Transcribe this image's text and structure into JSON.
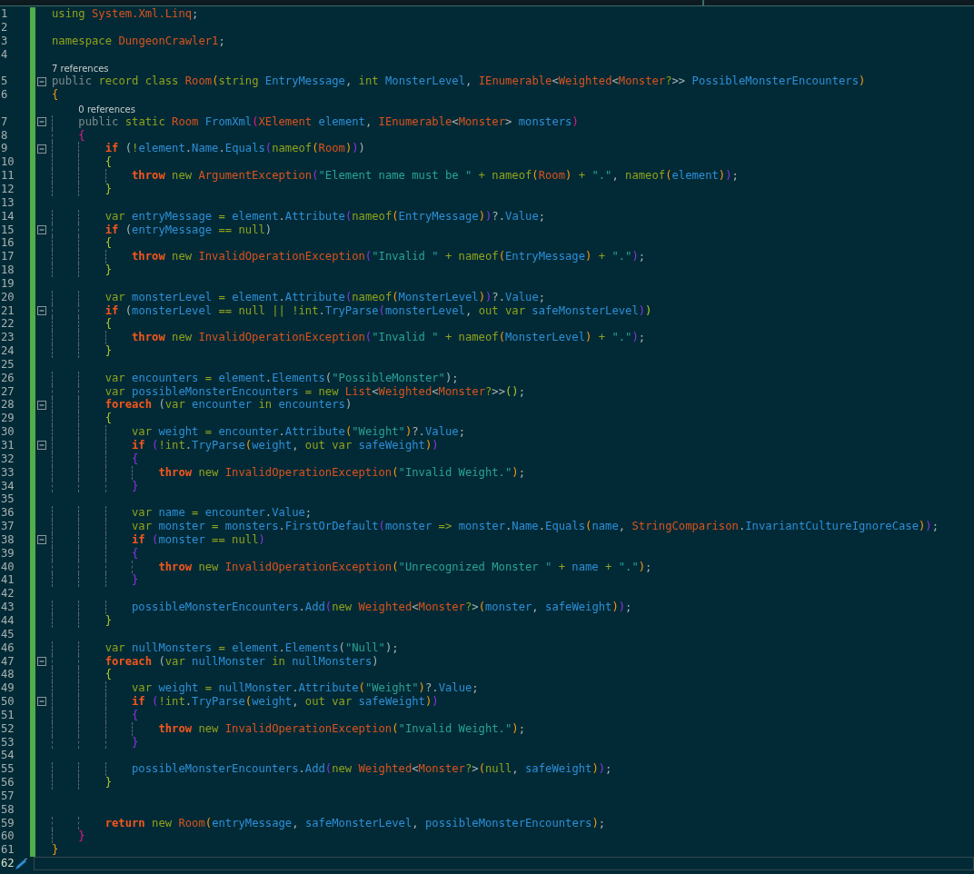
{
  "editor": {
    "lines": [
      {
        "n": "1",
        "modified": true,
        "collapsible": false,
        "current": false,
        "tokens": [
          {
            "kind": "k",
            "text": "using "
          },
          {
            "kind": "t",
            "text": "System.Xml.Linq"
          },
          {
            "kind": "p",
            "text": ";"
          }
        ]
      },
      {
        "n": "2",
        "modified": true,
        "collapsible": false,
        "current": false
      },
      {
        "n": "3",
        "modified": true,
        "collapsible": false,
        "current": false,
        "tokens": [
          {
            "kind": "k",
            "text": "namespace "
          },
          {
            "kind": "t",
            "text": "DungeonCrawler1"
          },
          {
            "kind": "p",
            "text": ";"
          }
        ]
      },
      {
        "n": "4",
        "modified": true,
        "collapsible": false,
        "current": false
      },
      {
        "n": "5",
        "modified": true,
        "collapsible": true,
        "current": false,
        "codelens": "7 references",
        "tokens": [
          {
            "kind": "m",
            "text": "public "
          },
          {
            "kind": "k",
            "text": "record class "
          },
          {
            "kind": "t",
            "text": "Room"
          },
          {
            "kind": "y",
            "text": "("
          },
          {
            "kind": "k",
            "text": "string "
          },
          {
            "kind": "i",
            "text": "EntryMessage"
          },
          {
            "kind": "p",
            "text": ", "
          },
          {
            "kind": "k",
            "text": "int "
          },
          {
            "kind": "i",
            "text": "MonsterLevel"
          },
          {
            "kind": "p",
            "text": ", "
          },
          {
            "kind": "t",
            "text": "IEnumerable"
          },
          {
            "kind": "p",
            "text": "<"
          },
          {
            "kind": "t",
            "text": "Weighted"
          },
          {
            "kind": "p",
            "text": "<"
          },
          {
            "kind": "t",
            "text": "Monster"
          },
          {
            "kind": "k",
            "text": "?"
          },
          {
            "kind": "p",
            "text": ">> "
          },
          {
            "kind": "i",
            "text": "PossibleMonsterEncounters"
          },
          {
            "kind": "y",
            "text": ")"
          }
        ]
      },
      {
        "n": "6",
        "modified": true,
        "collapsible": false,
        "current": false,
        "tokens": [
          {
            "kind": "y",
            "text": "{"
          }
        ]
      },
      {
        "n": "7",
        "modified": true,
        "collapsible": true,
        "current": false,
        "codelens": "0 references",
        "tokens": [
          {
            "kind": "m",
            "text": "    public "
          },
          {
            "kind": "k",
            "text": "static "
          },
          {
            "kind": "t",
            "text": "Room "
          },
          {
            "kind": "i",
            "text": "FromXml"
          },
          {
            "kind": "g",
            "text": "("
          },
          {
            "kind": "t",
            "text": "XElement "
          },
          {
            "kind": "i",
            "text": "element"
          },
          {
            "kind": "p",
            "text": ", "
          },
          {
            "kind": "t",
            "text": "IEnumerable"
          },
          {
            "kind": "p",
            "text": "<"
          },
          {
            "kind": "t",
            "text": "Monster"
          },
          {
            "kind": "p",
            "text": "> "
          },
          {
            "kind": "i",
            "text": "monsters"
          },
          {
            "kind": "g",
            "text": ")"
          }
        ]
      },
      {
        "n": "8",
        "modified": true,
        "collapsible": false,
        "current": false,
        "tokens": [
          {
            "kind": "g",
            "text": "    {"
          }
        ]
      },
      {
        "n": "9",
        "modified": true,
        "collapsible": true,
        "current": false,
        "tokens": [
          {
            "kind": "c",
            "text": "        if "
          },
          {
            "kind": "p",
            "text": "("
          },
          {
            "kind": "k",
            "text": "!"
          },
          {
            "kind": "i",
            "text": "element"
          },
          {
            "kind": "p",
            "text": "."
          },
          {
            "kind": "i",
            "text": "Name"
          },
          {
            "kind": "p",
            "text": "."
          },
          {
            "kind": "i",
            "text": "Equals"
          },
          {
            "kind": "v",
            "text": "("
          },
          {
            "kind": "k",
            "text": "nameof"
          },
          {
            "kind": "y",
            "text": "("
          },
          {
            "kind": "t",
            "text": "Room"
          },
          {
            "kind": "y",
            "text": ")"
          },
          {
            "kind": "v",
            "text": ")"
          },
          {
            "kind": "p",
            "text": ")"
          }
        ]
      },
      {
        "n": "10",
        "modified": true,
        "collapsible": false,
        "current": false,
        "tokens": [
          {
            "kind": "l",
            "text": "        {"
          }
        ]
      },
      {
        "n": "11",
        "modified": true,
        "collapsible": false,
        "current": false,
        "tokens": [
          {
            "kind": "c",
            "text": "            throw "
          },
          {
            "kind": "k",
            "text": "new "
          },
          {
            "kind": "t",
            "text": "ArgumentException"
          },
          {
            "kind": "v",
            "text": "("
          },
          {
            "kind": "s",
            "text": "\"Element name must be \""
          },
          {
            "kind": "k",
            "text": " + nameof"
          },
          {
            "kind": "y",
            "text": "("
          },
          {
            "kind": "t",
            "text": "Room"
          },
          {
            "kind": "y",
            "text": ")"
          },
          {
            "kind": "k",
            "text": " + "
          },
          {
            "kind": "s",
            "text": "\".\""
          },
          {
            "kind": "p",
            "text": ", "
          },
          {
            "kind": "k",
            "text": "nameof"
          },
          {
            "kind": "y",
            "text": "("
          },
          {
            "kind": "i",
            "text": "element"
          },
          {
            "kind": "y",
            "text": ")"
          },
          {
            "kind": "v",
            "text": ")"
          },
          {
            "kind": "p",
            "text": ";"
          }
        ]
      },
      {
        "n": "12",
        "modified": true,
        "collapsible": false,
        "current": false,
        "tokens": [
          {
            "kind": "l",
            "text": "        }"
          }
        ]
      },
      {
        "n": "13",
        "modified": true,
        "collapsible": false,
        "current": false
      },
      {
        "n": "14",
        "modified": true,
        "collapsible": false,
        "current": false,
        "tokens": [
          {
            "kind": "k",
            "text": "        var "
          },
          {
            "kind": "i",
            "text": "entryMessage"
          },
          {
            "kind": "k",
            "text": " = "
          },
          {
            "kind": "i",
            "text": "element"
          },
          {
            "kind": "p",
            "text": "."
          },
          {
            "kind": "i",
            "text": "Attribute"
          },
          {
            "kind": "v",
            "text": "("
          },
          {
            "kind": "k",
            "text": "nameof"
          },
          {
            "kind": "y",
            "text": "("
          },
          {
            "kind": "i",
            "text": "EntryMessage"
          },
          {
            "kind": "y",
            "text": ")"
          },
          {
            "kind": "v",
            "text": ")"
          },
          {
            "kind": "p",
            "text": "?."
          },
          {
            "kind": "i",
            "text": "Value"
          },
          {
            "kind": "p",
            "text": ";"
          }
        ]
      },
      {
        "n": "15",
        "modified": true,
        "collapsible": true,
        "current": false,
        "tokens": [
          {
            "kind": "c",
            "text": "        if "
          },
          {
            "kind": "p",
            "text": "("
          },
          {
            "kind": "i",
            "text": "entryMessage"
          },
          {
            "kind": "k",
            "text": " == null"
          },
          {
            "kind": "p",
            "text": ")"
          }
        ]
      },
      {
        "n": "16",
        "modified": true,
        "collapsible": false,
        "current": false,
        "tokens": [
          {
            "kind": "l",
            "text": "        {"
          }
        ]
      },
      {
        "n": "17",
        "modified": true,
        "collapsible": false,
        "current": false,
        "tokens": [
          {
            "kind": "c",
            "text": "            throw "
          },
          {
            "kind": "k",
            "text": "new "
          },
          {
            "kind": "t",
            "text": "InvalidOperationException"
          },
          {
            "kind": "v",
            "text": "("
          },
          {
            "kind": "s",
            "text": "\"Invalid \""
          },
          {
            "kind": "k",
            "text": " + nameof"
          },
          {
            "kind": "y",
            "text": "("
          },
          {
            "kind": "i",
            "text": "EntryMessage"
          },
          {
            "kind": "y",
            "text": ")"
          },
          {
            "kind": "k",
            "text": " + "
          },
          {
            "kind": "s",
            "text": "\".\""
          },
          {
            "kind": "v",
            "text": ")"
          },
          {
            "kind": "p",
            "text": ";"
          }
        ]
      },
      {
        "n": "18",
        "modified": true,
        "collapsible": false,
        "current": false,
        "tokens": [
          {
            "kind": "l",
            "text": "        }"
          }
        ]
      },
      {
        "n": "19",
        "modified": true,
        "collapsible": false,
        "current": false
      },
      {
        "n": "20",
        "modified": true,
        "collapsible": false,
        "current": false,
        "tokens": [
          {
            "kind": "k",
            "text": "        var "
          },
          {
            "kind": "i",
            "text": "monsterLevel"
          },
          {
            "kind": "k",
            "text": " = "
          },
          {
            "kind": "i",
            "text": "element"
          },
          {
            "kind": "p",
            "text": "."
          },
          {
            "kind": "i",
            "text": "Attribute"
          },
          {
            "kind": "v",
            "text": "("
          },
          {
            "kind": "k",
            "text": "nameof"
          },
          {
            "kind": "y",
            "text": "("
          },
          {
            "kind": "i",
            "text": "MonsterLevel"
          },
          {
            "kind": "y",
            "text": ")"
          },
          {
            "kind": "v",
            "text": ")"
          },
          {
            "kind": "p",
            "text": "?."
          },
          {
            "kind": "i",
            "text": "Value"
          },
          {
            "kind": "p",
            "text": ";"
          }
        ]
      },
      {
        "n": "21",
        "modified": true,
        "collapsible": true,
        "current": false,
        "tokens": [
          {
            "kind": "c",
            "text": "        if "
          },
          {
            "kind": "p",
            "text": "("
          },
          {
            "kind": "i",
            "text": "monsterLevel"
          },
          {
            "kind": "k",
            "text": " == null || !int"
          },
          {
            "kind": "p",
            "text": "."
          },
          {
            "kind": "i",
            "text": "TryParse"
          },
          {
            "kind": "v",
            "text": "("
          },
          {
            "kind": "i",
            "text": "monsterLevel"
          },
          {
            "kind": "p",
            "text": ", "
          },
          {
            "kind": "k",
            "text": "out var "
          },
          {
            "kind": "i",
            "text": "safeMonsterLevel"
          },
          {
            "kind": "v",
            "text": ")"
          },
          {
            "kind": "l",
            "text": ")"
          }
        ]
      },
      {
        "n": "22",
        "modified": true,
        "collapsible": false,
        "current": false,
        "tokens": [
          {
            "kind": "l",
            "text": "        {"
          }
        ]
      },
      {
        "n": "23",
        "modified": true,
        "collapsible": false,
        "current": false,
        "tokens": [
          {
            "kind": "c",
            "text": "            throw "
          },
          {
            "kind": "k",
            "text": "new "
          },
          {
            "kind": "t",
            "text": "InvalidOperationException"
          },
          {
            "kind": "v",
            "text": "("
          },
          {
            "kind": "s",
            "text": "\"Invalid \""
          },
          {
            "kind": "k",
            "text": " + nameof"
          },
          {
            "kind": "y",
            "text": "("
          },
          {
            "kind": "i",
            "text": "MonsterLevel"
          },
          {
            "kind": "y",
            "text": ")"
          },
          {
            "kind": "k",
            "text": " + "
          },
          {
            "kind": "s",
            "text": "\".\""
          },
          {
            "kind": "v",
            "text": ")"
          },
          {
            "kind": "p",
            "text": ";"
          }
        ]
      },
      {
        "n": "24",
        "modified": true,
        "collapsible": false,
        "current": false,
        "tokens": [
          {
            "kind": "l",
            "text": "        }"
          }
        ]
      },
      {
        "n": "25",
        "modified": true,
        "collapsible": false,
        "current": false
      },
      {
        "n": "26",
        "modified": true,
        "collapsible": false,
        "current": false,
        "tokens": [
          {
            "kind": "k",
            "text": "        var "
          },
          {
            "kind": "i",
            "text": "encounters"
          },
          {
            "kind": "k",
            "text": " = "
          },
          {
            "kind": "i",
            "text": "element"
          },
          {
            "kind": "p",
            "text": "."
          },
          {
            "kind": "i",
            "text": "Elements"
          },
          {
            "kind": "p",
            "text": "("
          },
          {
            "kind": "s",
            "text": "\"PossibleMonster\""
          },
          {
            "kind": "p",
            "text": ");"
          }
        ]
      },
      {
        "n": "27",
        "modified": true,
        "collapsible": false,
        "current": false,
        "tokens": [
          {
            "kind": "k",
            "text": "        var "
          },
          {
            "kind": "i",
            "text": "possibleMonsterEncounters"
          },
          {
            "kind": "k",
            "text": " = new "
          },
          {
            "kind": "t",
            "text": "List"
          },
          {
            "kind": "p",
            "text": "<"
          },
          {
            "kind": "t",
            "text": "Weighted"
          },
          {
            "kind": "p",
            "text": "<"
          },
          {
            "kind": "t",
            "text": "Monster"
          },
          {
            "kind": "k",
            "text": "?"
          },
          {
            "kind": "p",
            "text": ">>"
          },
          {
            "kind": "l",
            "text": "()"
          },
          {
            "kind": "p",
            "text": ";"
          }
        ]
      },
      {
        "n": "28",
        "modified": true,
        "collapsible": true,
        "current": false,
        "tokens": [
          {
            "kind": "c",
            "text": "        foreach "
          },
          {
            "kind": "p",
            "text": "("
          },
          {
            "kind": "k",
            "text": "var "
          },
          {
            "kind": "i",
            "text": "encounter"
          },
          {
            "kind": "k",
            "text": " in "
          },
          {
            "kind": "i",
            "text": "encounters"
          },
          {
            "kind": "p",
            "text": ")"
          }
        ]
      },
      {
        "n": "29",
        "modified": true,
        "collapsible": false,
        "current": false,
        "tokens": [
          {
            "kind": "l",
            "text": "        {"
          }
        ]
      },
      {
        "n": "30",
        "modified": true,
        "collapsible": false,
        "current": false,
        "tokens": [
          {
            "kind": "k",
            "text": "            var "
          },
          {
            "kind": "i",
            "text": "weight"
          },
          {
            "kind": "k",
            "text": " = "
          },
          {
            "kind": "i",
            "text": "encounter"
          },
          {
            "kind": "p",
            "text": "."
          },
          {
            "kind": "i",
            "text": "Attribute"
          },
          {
            "kind": "y",
            "text": "("
          },
          {
            "kind": "s",
            "text": "\"Weight\""
          },
          {
            "kind": "y",
            "text": ")"
          },
          {
            "kind": "p",
            "text": "?."
          },
          {
            "kind": "i",
            "text": "Value"
          },
          {
            "kind": "p",
            "text": ";"
          }
        ]
      },
      {
        "n": "31",
        "modified": true,
        "collapsible": true,
        "current": false,
        "tokens": [
          {
            "kind": "c",
            "text": "            if "
          },
          {
            "kind": "v",
            "text": "("
          },
          {
            "kind": "k",
            "text": "!int"
          },
          {
            "kind": "p",
            "text": "."
          },
          {
            "kind": "i",
            "text": "TryParse"
          },
          {
            "kind": "y",
            "text": "("
          },
          {
            "kind": "i",
            "text": "weight"
          },
          {
            "kind": "p",
            "text": ", "
          },
          {
            "kind": "k",
            "text": "out var "
          },
          {
            "kind": "i",
            "text": "safeWeight"
          },
          {
            "kind": "y",
            "text": ")"
          },
          {
            "kind": "v",
            "text": ")"
          }
        ]
      },
      {
        "n": "32",
        "modified": true,
        "collapsible": false,
        "current": false,
        "tokens": [
          {
            "kind": "v",
            "text": "            {"
          }
        ]
      },
      {
        "n": "33",
        "modified": true,
        "collapsible": false,
        "current": false,
        "tokens": [
          {
            "kind": "c",
            "text": "                throw "
          },
          {
            "kind": "k",
            "text": "new "
          },
          {
            "kind": "t",
            "text": "InvalidOperationException"
          },
          {
            "kind": "y",
            "text": "("
          },
          {
            "kind": "s",
            "text": "\"Invalid Weight.\""
          },
          {
            "kind": "y",
            "text": ")"
          },
          {
            "kind": "p",
            "text": ";"
          }
        ]
      },
      {
        "n": "34",
        "modified": true,
        "collapsible": false,
        "current": false,
        "tokens": [
          {
            "kind": "v",
            "text": "            }"
          }
        ]
      },
      {
        "n": "35",
        "modified": true,
        "collapsible": false,
        "current": false
      },
      {
        "n": "36",
        "modified": true,
        "collapsible": false,
        "current": false,
        "tokens": [
          {
            "kind": "k",
            "text": "            var "
          },
          {
            "kind": "i",
            "text": "name"
          },
          {
            "kind": "k",
            "text": " = "
          },
          {
            "kind": "i",
            "text": "encounter"
          },
          {
            "kind": "p",
            "text": "."
          },
          {
            "kind": "i",
            "text": "Value"
          },
          {
            "kind": "p",
            "text": ";"
          }
        ]
      },
      {
        "n": "37",
        "modified": true,
        "collapsible": false,
        "current": false,
        "tokens": [
          {
            "kind": "k",
            "text": "            var "
          },
          {
            "kind": "i",
            "text": "monster"
          },
          {
            "kind": "k",
            "text": " = "
          },
          {
            "kind": "i",
            "text": "monsters"
          },
          {
            "kind": "p",
            "text": "."
          },
          {
            "kind": "i",
            "text": "FirstOrDefault"
          },
          {
            "kind": "v",
            "text": "("
          },
          {
            "kind": "i",
            "text": "monster"
          },
          {
            "kind": "k",
            "text": " => "
          },
          {
            "kind": "i",
            "text": "monster"
          },
          {
            "kind": "p",
            "text": "."
          },
          {
            "kind": "i",
            "text": "Name"
          },
          {
            "kind": "p",
            "text": "."
          },
          {
            "kind": "i",
            "text": "Equals"
          },
          {
            "kind": "y",
            "text": "("
          },
          {
            "kind": "i",
            "text": "name"
          },
          {
            "kind": "p",
            "text": ", "
          },
          {
            "kind": "t",
            "text": "StringComparison"
          },
          {
            "kind": "p",
            "text": "."
          },
          {
            "kind": "i",
            "text": "InvariantCultureIgnoreCase"
          },
          {
            "kind": "y",
            "text": ")"
          },
          {
            "kind": "v",
            "text": ")"
          },
          {
            "kind": "p",
            "text": ";"
          }
        ]
      },
      {
        "n": "38",
        "modified": true,
        "collapsible": true,
        "current": false,
        "tokens": [
          {
            "kind": "c",
            "text": "            if "
          },
          {
            "kind": "v",
            "text": "("
          },
          {
            "kind": "i",
            "text": "monster"
          },
          {
            "kind": "k",
            "text": " == null"
          },
          {
            "kind": "v",
            "text": ")"
          }
        ]
      },
      {
        "n": "39",
        "modified": true,
        "collapsible": false,
        "current": false,
        "tokens": [
          {
            "kind": "v",
            "text": "            {"
          }
        ]
      },
      {
        "n": "40",
        "modified": true,
        "collapsible": false,
        "current": false,
        "tokens": [
          {
            "kind": "c",
            "text": "                throw "
          },
          {
            "kind": "k",
            "text": "new "
          },
          {
            "kind": "t",
            "text": "InvalidOperationException"
          },
          {
            "kind": "y",
            "text": "("
          },
          {
            "kind": "s",
            "text": "\"Unrecognized Monster \""
          },
          {
            "kind": "k",
            "text": " + "
          },
          {
            "kind": "i",
            "text": "name"
          },
          {
            "kind": "k",
            "text": " + "
          },
          {
            "kind": "s",
            "text": "\".\""
          },
          {
            "kind": "y",
            "text": ")"
          },
          {
            "kind": "p",
            "text": ";"
          }
        ]
      },
      {
        "n": "41",
        "modified": true,
        "collapsible": false,
        "current": false,
        "tokens": [
          {
            "kind": "v",
            "text": "            }"
          }
        ]
      },
      {
        "n": "42",
        "modified": true,
        "collapsible": false,
        "current": false
      },
      {
        "n": "43",
        "modified": true,
        "collapsible": false,
        "current": false,
        "tokens": [
          {
            "kind": "i",
            "text": "            possibleMonsterEncounters"
          },
          {
            "kind": "p",
            "text": "."
          },
          {
            "kind": "i",
            "text": "Add"
          },
          {
            "kind": "v",
            "text": "("
          },
          {
            "kind": "k",
            "text": "new "
          },
          {
            "kind": "t",
            "text": "Weighted"
          },
          {
            "kind": "p",
            "text": "<"
          },
          {
            "kind": "t",
            "text": "Monster"
          },
          {
            "kind": "k",
            "text": "?"
          },
          {
            "kind": "p",
            "text": ">"
          },
          {
            "kind": "y",
            "text": "("
          },
          {
            "kind": "i",
            "text": "monster"
          },
          {
            "kind": "p",
            "text": ", "
          },
          {
            "kind": "i",
            "text": "safeWeight"
          },
          {
            "kind": "y",
            "text": ")"
          },
          {
            "kind": "v",
            "text": ")"
          },
          {
            "kind": "p",
            "text": ";"
          }
        ]
      },
      {
        "n": "44",
        "modified": true,
        "collapsible": false,
        "current": false,
        "tokens": [
          {
            "kind": "l",
            "text": "        }"
          }
        ]
      },
      {
        "n": "45",
        "modified": true,
        "collapsible": false,
        "current": false
      },
      {
        "n": "46",
        "modified": true,
        "collapsible": false,
        "current": false,
        "tokens": [
          {
            "kind": "k",
            "text": "        var "
          },
          {
            "kind": "i",
            "text": "nullMonsters"
          },
          {
            "kind": "k",
            "text": " = "
          },
          {
            "kind": "i",
            "text": "element"
          },
          {
            "kind": "p",
            "text": "."
          },
          {
            "kind": "i",
            "text": "Elements"
          },
          {
            "kind": "p",
            "text": "("
          },
          {
            "kind": "s",
            "text": "\"Null\""
          },
          {
            "kind": "p",
            "text": ");"
          }
        ]
      },
      {
        "n": "47",
        "modified": true,
        "collapsible": true,
        "current": false,
        "tokens": [
          {
            "kind": "c",
            "text": "        foreach "
          },
          {
            "kind": "p",
            "text": "("
          },
          {
            "kind": "k",
            "text": "var "
          },
          {
            "kind": "i",
            "text": "nullMonster"
          },
          {
            "kind": "k",
            "text": " in "
          },
          {
            "kind": "i",
            "text": "nullMonsters"
          },
          {
            "kind": "p",
            "text": ")"
          }
        ]
      },
      {
        "n": "48",
        "modified": true,
        "collapsible": false,
        "current": false,
        "tokens": [
          {
            "kind": "l",
            "text": "        {"
          }
        ]
      },
      {
        "n": "49",
        "modified": true,
        "collapsible": false,
        "current": false,
        "tokens": [
          {
            "kind": "k",
            "text": "            var "
          },
          {
            "kind": "i",
            "text": "weight"
          },
          {
            "kind": "k",
            "text": " = "
          },
          {
            "kind": "i",
            "text": "nullMonster"
          },
          {
            "kind": "p",
            "text": "."
          },
          {
            "kind": "i",
            "text": "Attribute"
          },
          {
            "kind": "y",
            "text": "("
          },
          {
            "kind": "s",
            "text": "\"Weight\""
          },
          {
            "kind": "y",
            "text": ")"
          },
          {
            "kind": "p",
            "text": "?."
          },
          {
            "kind": "i",
            "text": "Value"
          },
          {
            "kind": "p",
            "text": ";"
          }
        ]
      },
      {
        "n": "50",
        "modified": true,
        "collapsible": true,
        "current": false,
        "tokens": [
          {
            "kind": "c",
            "text": "            if "
          },
          {
            "kind": "v",
            "text": "("
          },
          {
            "kind": "k",
            "text": "!int"
          },
          {
            "kind": "p",
            "text": "."
          },
          {
            "kind": "i",
            "text": "TryParse"
          },
          {
            "kind": "y",
            "text": "("
          },
          {
            "kind": "i",
            "text": "weight"
          },
          {
            "kind": "p",
            "text": ", "
          },
          {
            "kind": "k",
            "text": "out var "
          },
          {
            "kind": "i",
            "text": "safeWeight"
          },
          {
            "kind": "y",
            "text": ")"
          },
          {
            "kind": "v",
            "text": ")"
          }
        ]
      },
      {
        "n": "51",
        "modified": true,
        "collapsible": false,
        "current": false,
        "tokens": [
          {
            "kind": "v",
            "text": "            {"
          }
        ]
      },
      {
        "n": "52",
        "modified": true,
        "collapsible": false,
        "current": false,
        "tokens": [
          {
            "kind": "c",
            "text": "                throw "
          },
          {
            "kind": "k",
            "text": "new "
          },
          {
            "kind": "t",
            "text": "InvalidOperationException"
          },
          {
            "kind": "y",
            "text": "("
          },
          {
            "kind": "s",
            "text": "\"Invalid Weight.\""
          },
          {
            "kind": "y",
            "text": ")"
          },
          {
            "kind": "p",
            "text": ";"
          }
        ]
      },
      {
        "n": "53",
        "modified": true,
        "collapsible": false,
        "current": false,
        "tokens": [
          {
            "kind": "v",
            "text": "            }"
          }
        ]
      },
      {
        "n": "54",
        "modified": true,
        "collapsible": false,
        "current": false
      },
      {
        "n": "55",
        "modified": true,
        "collapsible": false,
        "current": false,
        "tokens": [
          {
            "kind": "i",
            "text": "            possibleMonsterEncounters"
          },
          {
            "kind": "p",
            "text": "."
          },
          {
            "kind": "i",
            "text": "Add"
          },
          {
            "kind": "v",
            "text": "("
          },
          {
            "kind": "k",
            "text": "new "
          },
          {
            "kind": "t",
            "text": "Weighted"
          },
          {
            "kind": "p",
            "text": "<"
          },
          {
            "kind": "t",
            "text": "Monster"
          },
          {
            "kind": "k",
            "text": "?"
          },
          {
            "kind": "p",
            "text": ">"
          },
          {
            "kind": "y",
            "text": "("
          },
          {
            "kind": "k",
            "text": "null"
          },
          {
            "kind": "p",
            "text": ", "
          },
          {
            "kind": "i",
            "text": "safeWeight"
          },
          {
            "kind": "y",
            "text": ")"
          },
          {
            "kind": "v",
            "text": ")"
          },
          {
            "kind": "p",
            "text": ";"
          }
        ]
      },
      {
        "n": "56",
        "modified": true,
        "collapsible": false,
        "current": false,
        "tokens": [
          {
            "kind": "l",
            "text": "        }"
          }
        ]
      },
      {
        "n": "57",
        "modified": true,
        "collapsible": false,
        "current": false
      },
      {
        "n": "58",
        "modified": true,
        "collapsible": false,
        "current": false
      },
      {
        "n": "59",
        "modified": true,
        "collapsible": false,
        "current": false,
        "tokens": [
          {
            "kind": "c",
            "text": "        return "
          },
          {
            "kind": "k",
            "text": "new "
          },
          {
            "kind": "t",
            "text": "Room"
          },
          {
            "kind": "y",
            "text": "("
          },
          {
            "kind": "i",
            "text": "entryMessage"
          },
          {
            "kind": "p",
            "text": ", "
          },
          {
            "kind": "i",
            "text": "safeMonsterLevel"
          },
          {
            "kind": "p",
            "text": ", "
          },
          {
            "kind": "i",
            "text": "possibleMonsterEncounters"
          },
          {
            "kind": "y",
            "text": ")"
          },
          {
            "kind": "p",
            "text": ";"
          }
        ]
      },
      {
        "n": "60",
        "modified": true,
        "collapsible": false,
        "current": false,
        "tokens": [
          {
            "kind": "g",
            "text": "    }"
          }
        ]
      },
      {
        "n": "61",
        "modified": true,
        "collapsible": false,
        "current": false,
        "tokens": [
          {
            "kind": "y",
            "text": "}"
          }
        ]
      },
      {
        "n": "62",
        "modified": false,
        "collapsible": false,
        "current": true
      }
    ]
  }
}
